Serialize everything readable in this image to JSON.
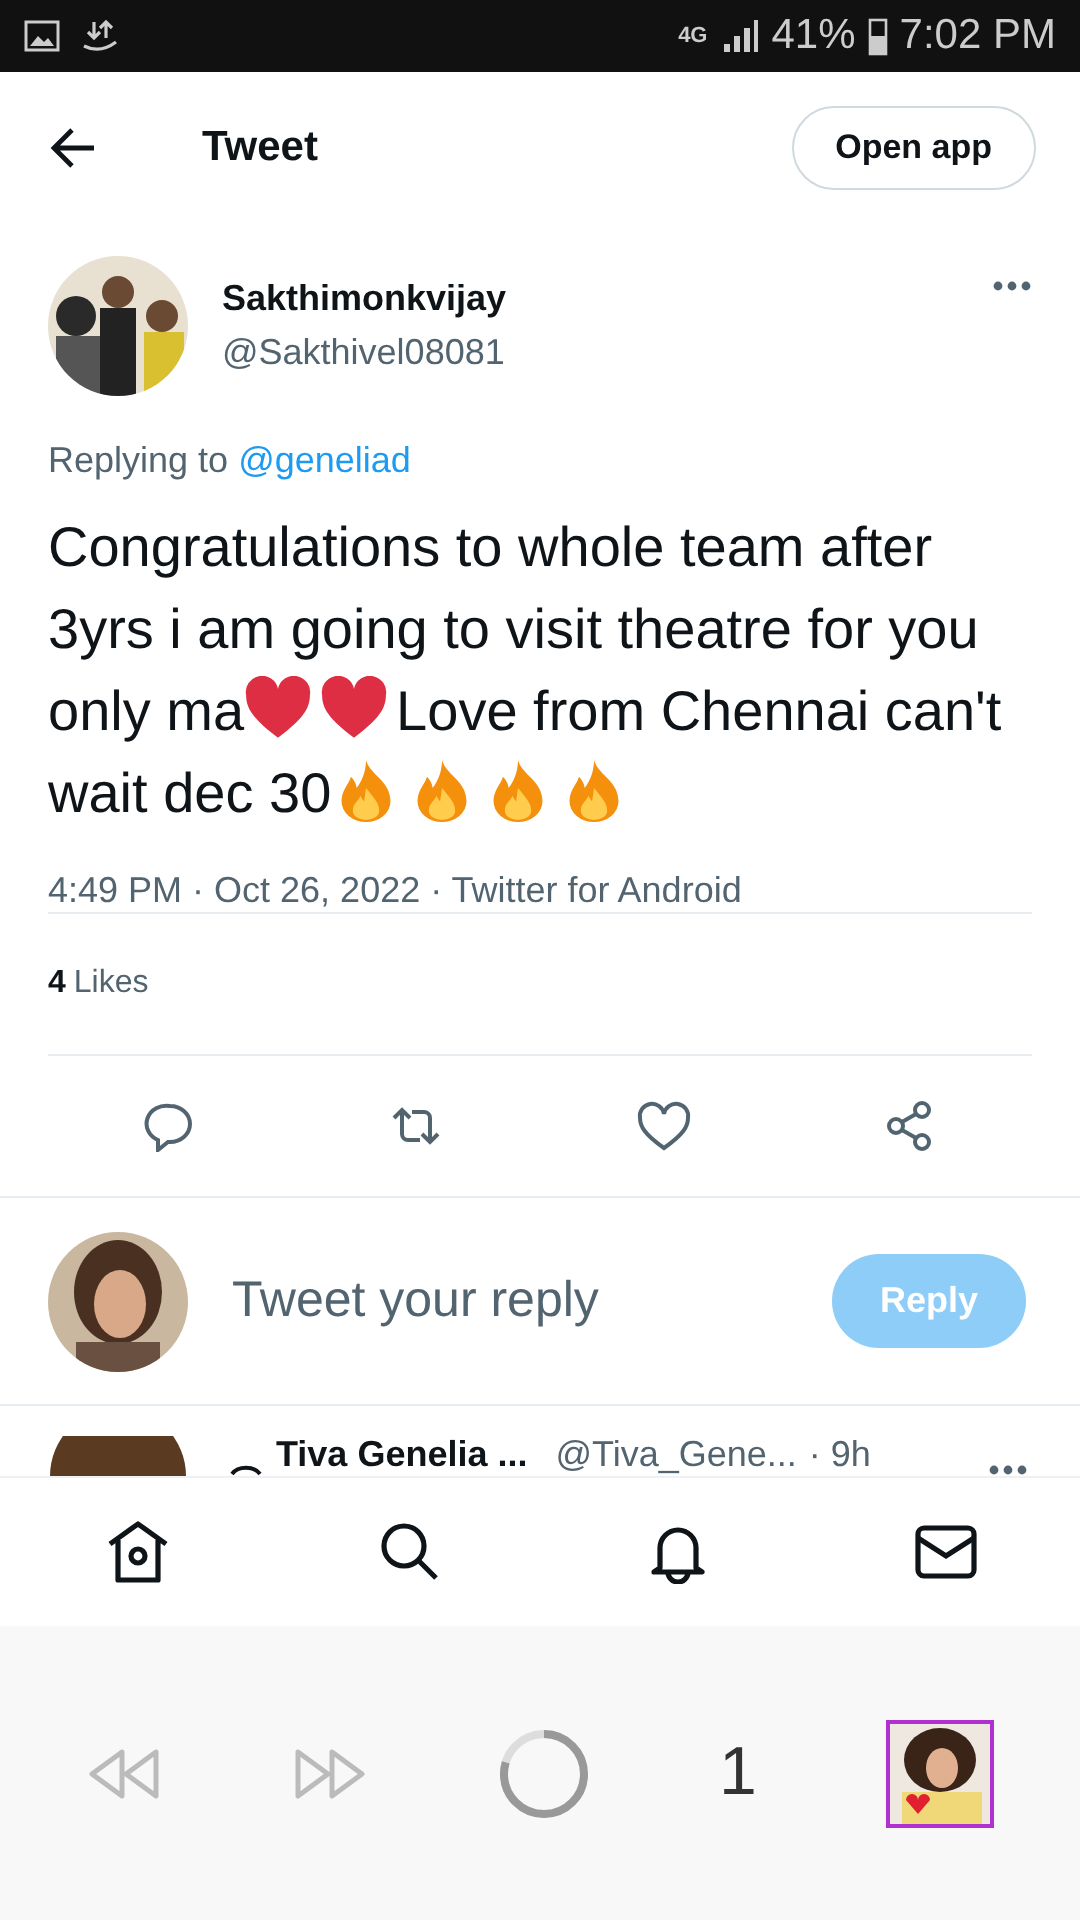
{
  "status_bar": {
    "network": "4G",
    "battery": "41%",
    "time": "7:02 PM"
  },
  "header": {
    "title": "Tweet",
    "open_app": "Open app"
  },
  "tweet": {
    "name": "Sakthimonkvijay",
    "handle": "@Sakthivel08081",
    "replying_label": "Replying to",
    "replying_to": "@geneliad",
    "body": [
      {
        "kind": "text",
        "text": "Congratulations to whole team after 3yrs i am going to visit theatre for you only ma"
      },
      {
        "kind": "heart"
      },
      {
        "kind": "heart"
      },
      {
        "kind": "text",
        "text": "Love from Chennai can't wait dec 30"
      },
      {
        "kind": "fire"
      },
      {
        "kind": "fire"
      },
      {
        "kind": "fire"
      },
      {
        "kind": "fire"
      }
    ],
    "meta": "4:49 PM · Oct 26, 2022 · Twitter for Android",
    "likes_count": "4",
    "likes_label": "Likes"
  },
  "reply": {
    "placeholder": "Tweet your reply",
    "button": "Reply"
  },
  "next_tweet": {
    "name": "Tiva Genelia ...",
    "handle": "@Tiva_Gene...",
    "time": "· 9h"
  },
  "tab_count": "1"
}
